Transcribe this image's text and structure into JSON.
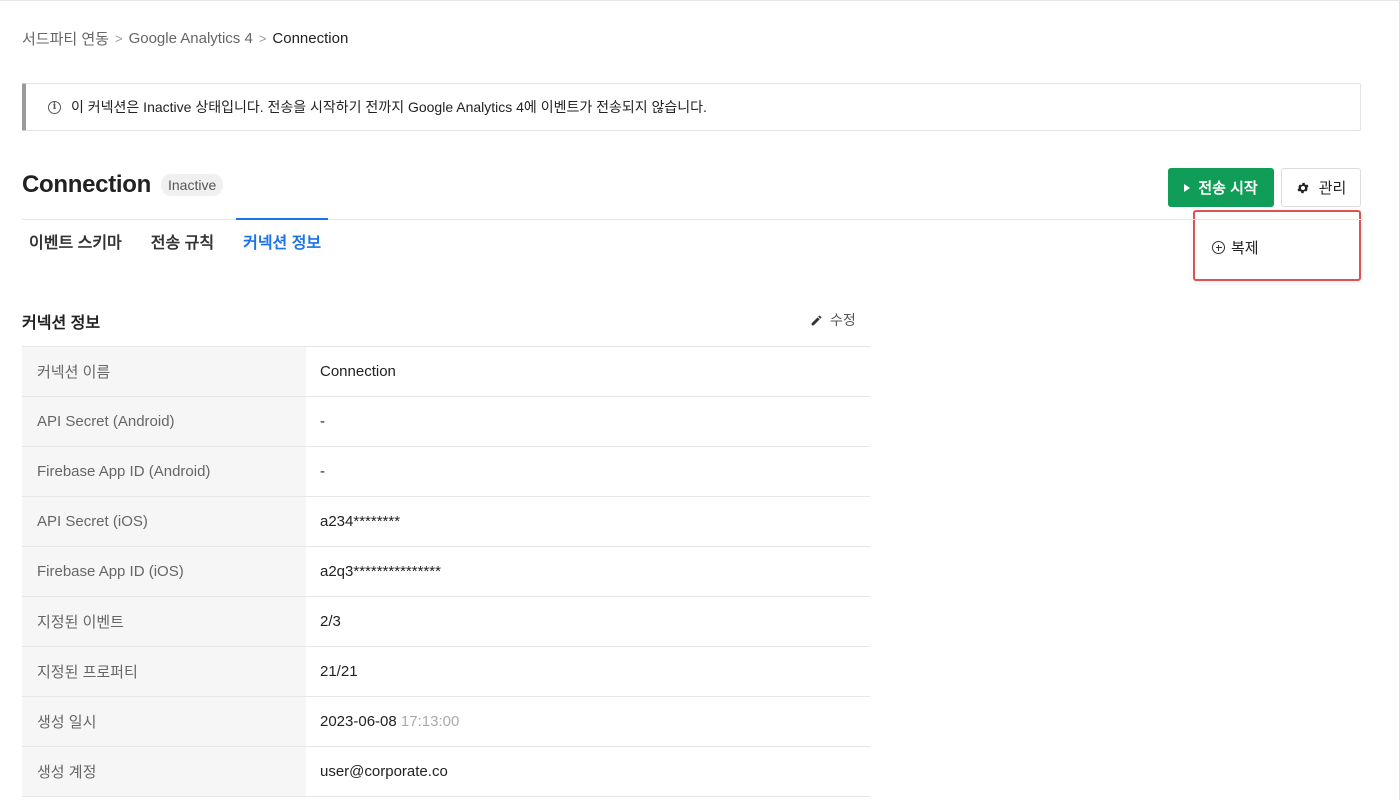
{
  "breadcrumb": {
    "items": [
      "서드파티 연동",
      "Google Analytics 4",
      "Connection"
    ],
    "separator": ">"
  },
  "notice": {
    "text": "이 커넥션은 Inactive 상태입니다. 전송을 시작하기 전까지 Google Analytics 4에 이벤트가 전송되지 않습니다.",
    "icon": "info-icon",
    "icon_glyph": "i"
  },
  "header": {
    "title": "Connection",
    "status": "Inactive"
  },
  "actions": {
    "start_label": "전송 시작",
    "manage_label": "관리",
    "start_color": "#0f9d58"
  },
  "manage_menu": {
    "items": [
      "복제"
    ],
    "highlight_color": "#e05151"
  },
  "tabs": [
    {
      "label": "이벤트 스키마",
      "active": false
    },
    {
      "label": "전송 규칙",
      "active": false
    },
    {
      "label": "커넥션 정보",
      "active": true
    }
  ],
  "section": {
    "title": "커넥션 정보",
    "edit_label": "수정"
  },
  "info_rows": [
    {
      "label": "커넥션 이름",
      "value": "Connection"
    },
    {
      "label": "API Secret (Android)",
      "value": "-"
    },
    {
      "label": "Firebase App ID (Android)",
      "value": "-"
    },
    {
      "label": "API Secret (iOS)",
      "value": "a234********"
    },
    {
      "label": "Firebase App ID (iOS)",
      "value": "a2q3***************"
    },
    {
      "label": "지정된 이벤트",
      "value": "2/3"
    },
    {
      "label": "지정된 프로퍼티",
      "value": "21/21"
    },
    {
      "label": "생성 일시",
      "value": "2023-06-08",
      "time": "17:13:00"
    },
    {
      "label": "생성 계정",
      "value": "user@corporate.co"
    }
  ],
  "accent_color": "#1a73e8"
}
